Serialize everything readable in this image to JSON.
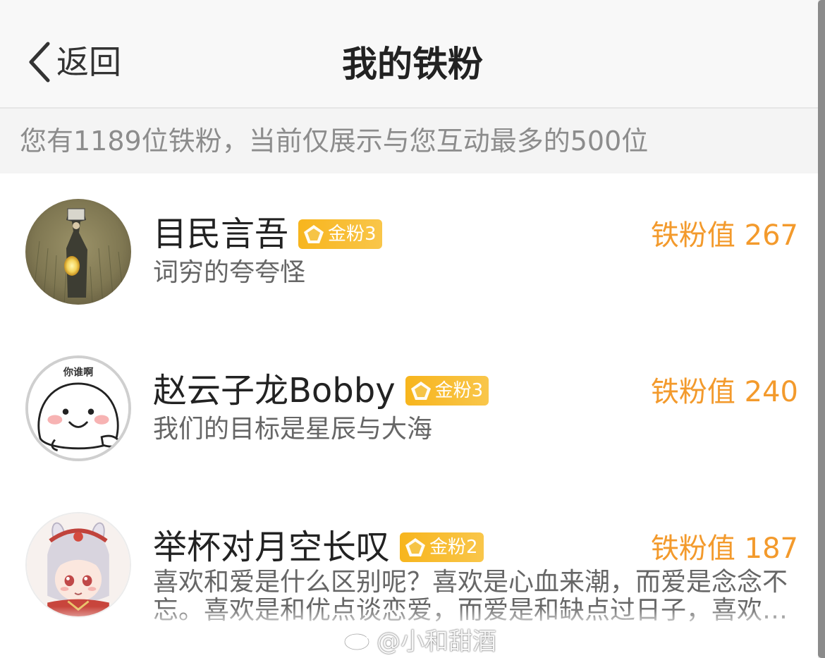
{
  "navbar": {
    "back_label": "返回",
    "title": "我的铁粉"
  },
  "info_bar": {
    "text": "您有1189位铁粉，当前仅展示与您互动最多的500位"
  },
  "fans": [
    {
      "name": "目民言吾",
      "badge": "金粉3",
      "description": "词穷的夸夸怪",
      "score": "铁粉值 267",
      "avatar_icon": "lantern-painting-avatar"
    },
    {
      "name": "赵云子龙Bobby",
      "badge": "金粉3",
      "description": "我们的目标是星辰与大海",
      "score": "铁粉值 240",
      "avatar_icon": "cartoon-face-avatar",
      "avatar_caption": "你谁啊"
    },
    {
      "name": "举杯对月空长叹",
      "badge": "金粉2",
      "description": "喜欢和爱是什么区别呢？喜欢是心血来潮，而爱是念念不忘。喜欢是和优点谈恋爱，而爱是和缺点过日子，喜欢…",
      "score": "铁粉值 187",
      "avatar_icon": "anime-girl-avatar"
    }
  ],
  "watermark": {
    "text": "@小和甜酒",
    "icon": "weibo-icon"
  },
  "colors": {
    "accent": "#f39a2c",
    "badge": "#f7b51d",
    "info_text": "#8c8c8c",
    "navbar_bg": "#f8f8f8"
  }
}
